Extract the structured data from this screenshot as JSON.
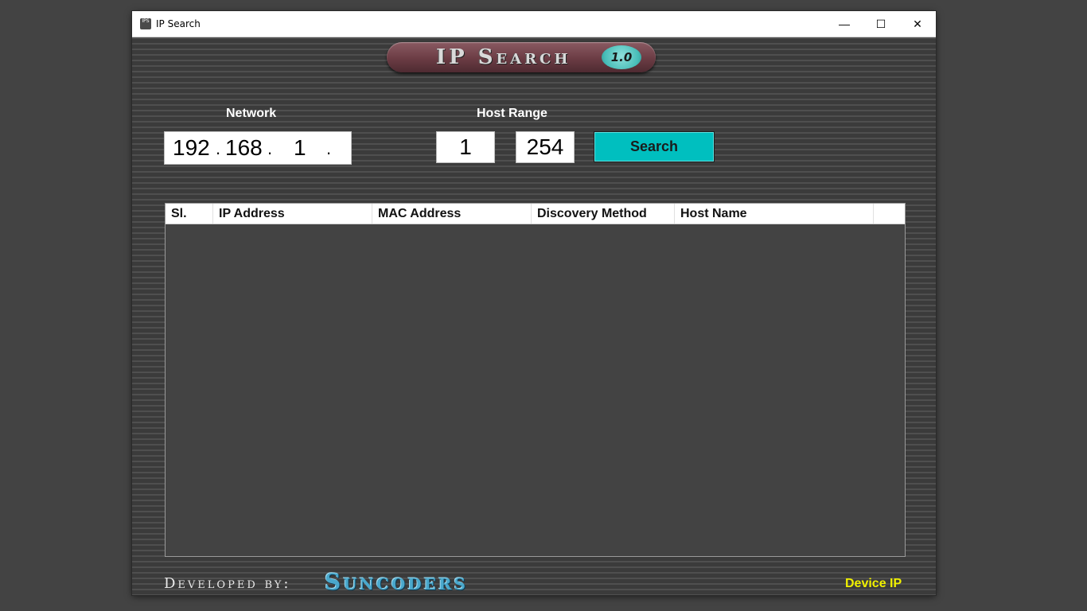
{
  "window": {
    "title": "IP Search",
    "icon_text": "IPS",
    "controls": {
      "minimize": "—",
      "maximize": "☐",
      "close": "✕"
    }
  },
  "logo": {
    "title": "IP Search",
    "version": "1.0"
  },
  "network": {
    "label": "Network",
    "octet1": "192",
    "octet2": "168",
    "octet3": "1",
    "dot": "."
  },
  "host_range": {
    "label": "Host Range",
    "start": "1",
    "end": "254"
  },
  "search_button": {
    "label": "Search"
  },
  "table": {
    "columns": [
      "Sl.",
      "IP Address",
      "MAC Address",
      "Discovery Method",
      "Host Name",
      ""
    ],
    "rows": []
  },
  "footer": {
    "developed_by": "Developed by:",
    "brand": "Suncoders",
    "device_ip_link": "Device IP"
  },
  "colors": {
    "accent": "#00bfbf",
    "link": "#f0f000",
    "background": "#434343"
  }
}
